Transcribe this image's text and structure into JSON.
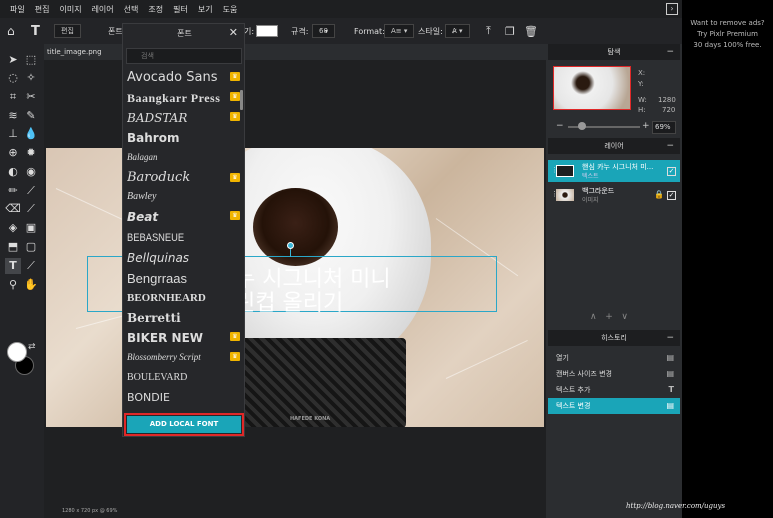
{
  "menubar": {
    "items": [
      "파일",
      "편집",
      "이미지",
      "레이어",
      "선택",
      "조정",
      "필터",
      "보기",
      "도움"
    ]
  },
  "options_bar": {
    "edit_button": "편집",
    "font_label": "폰트",
    "size_prefix": "기:",
    "spacing_label": "규격:",
    "size_value": "60",
    "format_label": "Format:",
    "style_label": "스타일:"
  },
  "document": {
    "tab_name": "title_image.png",
    "canvas_text_line1": "핸심 카누 시그니처 미니",
    "canvas_text_line2": "브런치 캠 올리기",
    "canvas_text_line1_visible": "누 시그니처 미니",
    "canvas_text_line2_visible": "린컵 올리기",
    "dripper_label": "HAFEDE KONA",
    "canvas_size": "1280 x 720 px @ 69%"
  },
  "font_panel": {
    "title": "폰트",
    "search_placeholder": "검색",
    "fonts": [
      {
        "name": "Avocado Sans",
        "premium": true
      },
      {
        "name": "Baangkarr Press",
        "premium": true
      },
      {
        "name": "BADSTAR",
        "premium": true
      },
      {
        "name": "Bahrom",
        "premium": false
      },
      {
        "name": "Balagan",
        "premium": false
      },
      {
        "name": "Baroduck",
        "premium": true
      },
      {
        "name": "Bawley",
        "premium": false
      },
      {
        "name": "Beat",
        "premium": true
      },
      {
        "name": "BEBASNEUE",
        "premium": false
      },
      {
        "name": "Bellquinas",
        "premium": false
      },
      {
        "name": "Bengrraas",
        "premium": false
      },
      {
        "name": "BEORNHEARD",
        "premium": false
      },
      {
        "name": "Berretti",
        "premium": false
      },
      {
        "name": "BIKER NEW",
        "premium": true
      },
      {
        "name": "Blossomberry Script",
        "premium": true
      },
      {
        "name": "BOULEVARD",
        "premium": false
      },
      {
        "name": "BONDIE",
        "premium": false
      }
    ],
    "add_button": "ADD LOCAL FONT"
  },
  "navigator": {
    "title": "탐색",
    "x_label": "X:",
    "y_label": "Y:",
    "w_label": "W:",
    "w_value": "1280",
    "h_label": "H:",
    "h_value": "720",
    "zoom": "69%"
  },
  "layers": {
    "title": "레이어",
    "items": [
      {
        "name": "핸심 카누 시그니처 미...",
        "type": "텍스트",
        "selected": true
      },
      {
        "name": "백그라운드",
        "type": "이미지",
        "selected": false
      }
    ]
  },
  "history": {
    "title": "히스토리",
    "items": [
      {
        "label": "열기",
        "selected": false
      },
      {
        "label": "캔버스 사이즈 변경",
        "selected": false
      },
      {
        "label": "텍스트 추가",
        "selected": false
      },
      {
        "label": "텍스트 변경",
        "selected": true
      }
    ]
  },
  "ad": {
    "line1": "Want to remove ads?",
    "line2": "Try Pixlr Premium",
    "line3": "30 days 100% free."
  },
  "watermark": "http://blog.naver.com/uguys",
  "colors": {
    "accent": "#1aa5b8",
    "highlight_border": "#e02828",
    "premium_crown": "#f0b400"
  }
}
